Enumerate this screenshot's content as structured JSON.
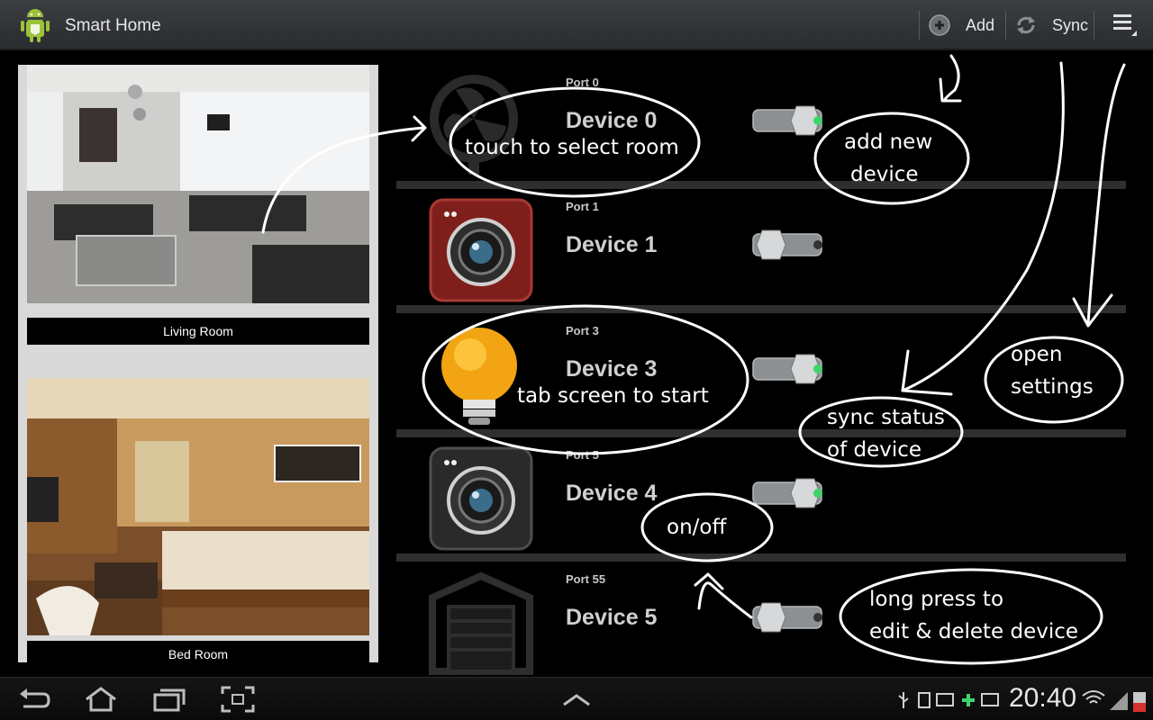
{
  "app": {
    "title": "Smart Home",
    "add_label": "Add",
    "sync_label": "Sync",
    "icons": {
      "logo": "android-logo-icon",
      "add": "add-circle-icon",
      "sync": "sync-icon",
      "menu": "overflow-menu-icon"
    }
  },
  "rooms": [
    {
      "label": "Living Room",
      "image": "living-room-photo"
    },
    {
      "label": "Bed Room",
      "image": "bed-room-photo"
    }
  ],
  "devices": [
    {
      "port": "Port 0",
      "name": "Device 0",
      "icon": "fan-icon",
      "on": true
    },
    {
      "port": "Port 1",
      "name": "Device 1",
      "icon": "camera-red-icon",
      "on": false
    },
    {
      "port": "Port 3",
      "name": "Device 3",
      "icon": "light-bulb-icon",
      "on": true
    },
    {
      "port": "Port 5",
      "name": "Device 4",
      "icon": "camera-dark-icon",
      "on": true
    },
    {
      "port": "Port 55",
      "name": "Device 5",
      "icon": "garage-door-icon",
      "on": false
    }
  ],
  "annotations": {
    "select_room": "touch to select room",
    "add_device_1": "add new",
    "add_device_2": "device",
    "start_1": "tab screen to start",
    "sync_status_1": "sync status",
    "sync_status_2": "of device",
    "settings_1": "open",
    "settings_2": "settings",
    "on_off": "on/off",
    "long_press_1": "long press to",
    "long_press_2": "edit & delete device"
  },
  "statusbar": {
    "time": "20:40",
    "icons": [
      "usb-icon",
      "sd-card-icon",
      "mail-icon",
      "add-icon",
      "email-icon",
      "wifi-icon",
      "signal-icon",
      "battery-icon"
    ]
  },
  "navbar": {
    "icons": [
      "back-icon",
      "home-icon",
      "recent-apps-icon",
      "screenshot-icon",
      "up-arrow-icon"
    ]
  },
  "colors": {
    "toggle_on_led": "#3fd46b",
    "toggle_off_led": "#333333",
    "actionbar": "#33363a"
  }
}
